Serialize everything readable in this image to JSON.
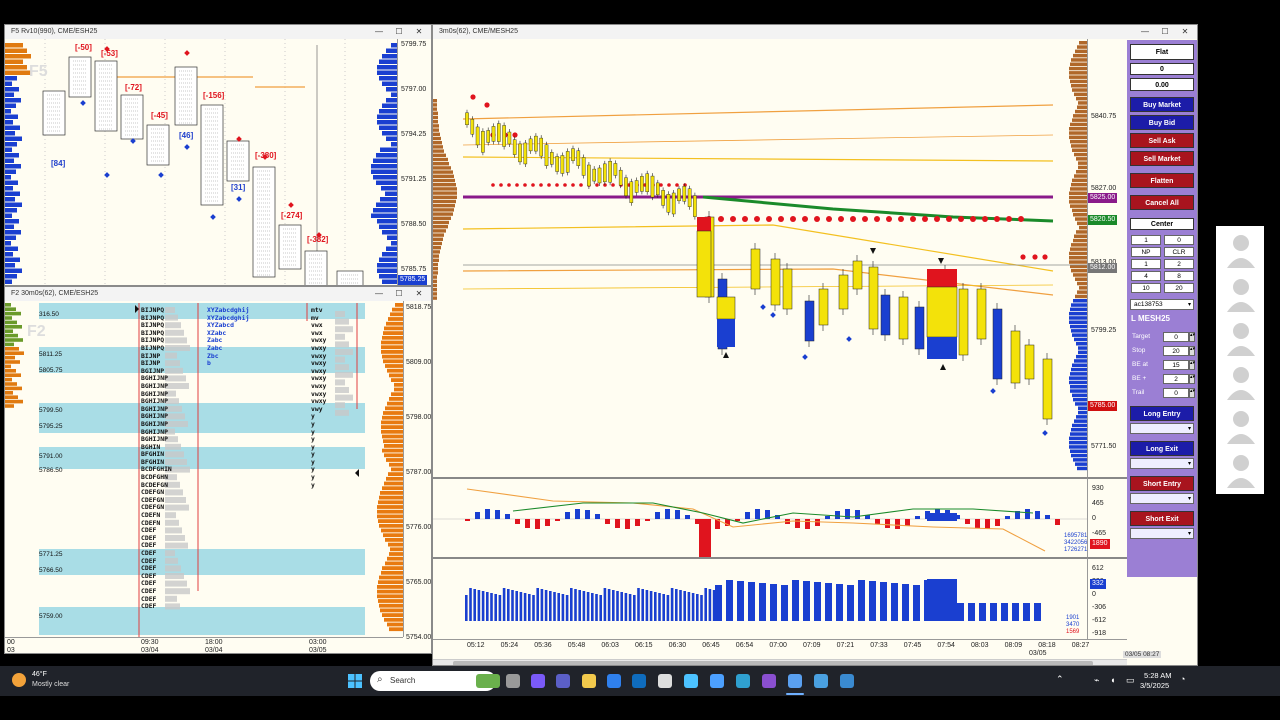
{
  "windows": {
    "topleft": {
      "title": "F5 Rv10(990), CME/ESH25",
      "watermark": "F5",
      "prices": [
        "5799.75",
        "5797.00",
        "5794.25",
        "5791.25",
        "5788.50",
        "5785.75"
      ],
      "current_price": "5785.25",
      "deltas": [
        {
          "text": "[84]",
          "color": "#1f3fcc"
        },
        {
          "text": "[-50]",
          "color": "#e0141e"
        },
        {
          "text": "[-53]",
          "color": "#e0141e"
        },
        {
          "text": "[-72]",
          "color": "#e0141e"
        },
        {
          "text": "[-45]",
          "color": "#e0141e"
        },
        {
          "text": "[46]",
          "color": "#1f3fcc"
        },
        {
          "text": "[-156]",
          "color": "#e0141e"
        },
        {
          "text": "[31]",
          "color": "#1f3fcc"
        },
        {
          "text": "[-380]",
          "color": "#e0141e"
        },
        {
          "text": "[-274]",
          "color": "#e0141e"
        },
        {
          "text": "[-382]",
          "color": "#e0141e"
        }
      ]
    },
    "tpo": {
      "title": "F2 30m0s(62), CME/ESH25",
      "watermark": "F2",
      "levels": [
        "316.50",
        "5811.25",
        "5805.75",
        "5799.50",
        "5795.25",
        "5791.00",
        "5786.50",
        "5771.25",
        "5766.50",
        "5759.00"
      ],
      "axis_prices": [
        "5818.75",
        "5809.00",
        "5798.00",
        "5787.00",
        "5776.00",
        "5765.00",
        "5754.00"
      ],
      "time_labels": [
        {
          "time": "00",
          "date": "03"
        },
        {
          "time": "09:30",
          "date": "03/04"
        },
        {
          "time": "18:00",
          "date": "03/04"
        },
        {
          "time": "03:00",
          "date": "03/05"
        }
      ],
      "col1": "BIJNPQ\nBIJNPQ\nBIJNPQ\nBIJNPQ\nBIJNPQ\nBIJNPQ\nBIJNP\nBIJNP\nBGIJNP\nBGHIJNP\nBGHIJNP\nBGHIJNP\nBGHIJNP\nBGHIJNP\nBGHIJNP\nBGHIJNP\nBGHIJNP\nBGHIJNP\nBGHIN\nBFGHIN\nBFGHIN\nBCDFGHIN\nBCDFGHN\nBCDEFGN\nCDEFGN\nCDEFGN\nCDEFGN\nCDEFN\nCDEFN\nCDEF\nCDEF\nCDEF\nCDEF\nCDEF\nCDEF\nCDEF\nCDEF\nCDEF\nCDEF\nCDEF",
      "col2": "XYZabcdghij\nXYZabcdghij\nXYZabcd\nXZabc\nZabc\nZabc\nZbc\nb",
      "col3": "mtv\nmv\nvwx\nvwx\nvwxy\nvwxy\nvwxy\nvwxy\nvwxy\nvwxy\nvwxy\nvwxy\nvwxy\nvwy\ny\ny\ny\ny\ny\ny\ny\ny\ny\ny"
    },
    "main": {
      "title": "3m0s(62), CME/MESH25",
      "prices": [
        {
          "text": "5840.75"
        },
        {
          "text": "5827.00"
        },
        {
          "text": "5813.00"
        },
        {
          "text": "5799.25"
        },
        {
          "text": "5771.50"
        }
      ],
      "tags": [
        {
          "text": "5825.00",
          "bg": "#8a1a8a"
        },
        {
          "text": "5820.50",
          "bg": "#1a8a2a"
        },
        {
          "text": "5812.00",
          "bg": "#777777"
        },
        {
          "text": "5785.00",
          "bg": "#d01010"
        }
      ],
      "delta_axis": [
        "930",
        "465",
        "0",
        "-465"
      ],
      "volume_axis": [
        "612",
        "306",
        "0",
        "-306",
        "-612",
        "-918"
      ],
      "small_labels": [
        "1695781",
        "3422056",
        "1726271",
        "1901",
        "3470",
        "1569",
        "1890",
        "332"
      ],
      "time_labels": [
        "05:12",
        "05:24",
        "05:36",
        "05:48",
        "06:03",
        "06:15",
        "06:30",
        "06:45",
        "06:54",
        "07:00",
        "07:09",
        "07:21",
        "07:33",
        "07:45",
        "07:54",
        "08:03",
        "08:09",
        "08:18",
        "08:27"
      ],
      "end_date": "03/05",
      "corner_timestamp": "03/05 08:27"
    }
  },
  "panel": {
    "status": "Flat",
    "qty": "0",
    "pnl": "0.00",
    "buttons_top": [
      {
        "label": "Buy Market",
        "style": "blue"
      },
      {
        "label": "Buy Bid",
        "style": "blue"
      },
      {
        "label": "Sell Ask",
        "style": "red"
      },
      {
        "label": "Sell Market",
        "style": "red"
      },
      {
        "label": "Flatten",
        "style": "red"
      },
      {
        "label": "Cancel All",
        "style": "red"
      }
    ],
    "center": "Center",
    "grid": [
      "1",
      "0",
      "NP",
      "CLR",
      "1",
      "2",
      "4",
      "8",
      "10",
      "20"
    ],
    "account": "ac138753",
    "symbol": "L MESH25",
    "fields": [
      {
        "label": "Target",
        "value": "0"
      },
      {
        "label": "Stop",
        "value": "20"
      },
      {
        "label": "BE at",
        "value": "15"
      },
      {
        "label": "BE +",
        "value": "2"
      },
      {
        "label": "Trail",
        "value": "0"
      }
    ],
    "entry_buttons": [
      {
        "label": "Long Entry",
        "style": "blue"
      },
      {
        "label": "Long Exit",
        "style": "blue"
      },
      {
        "label": "Short Entry",
        "style": "red"
      },
      {
        "label": "Short Exit",
        "style": "red"
      }
    ]
  },
  "taskbar": {
    "weather_temp": "46°F",
    "weather_desc": "Mostly clear",
    "search_placeholder": "Search",
    "time": "5:28 AM",
    "date": "3/5/2025"
  }
}
